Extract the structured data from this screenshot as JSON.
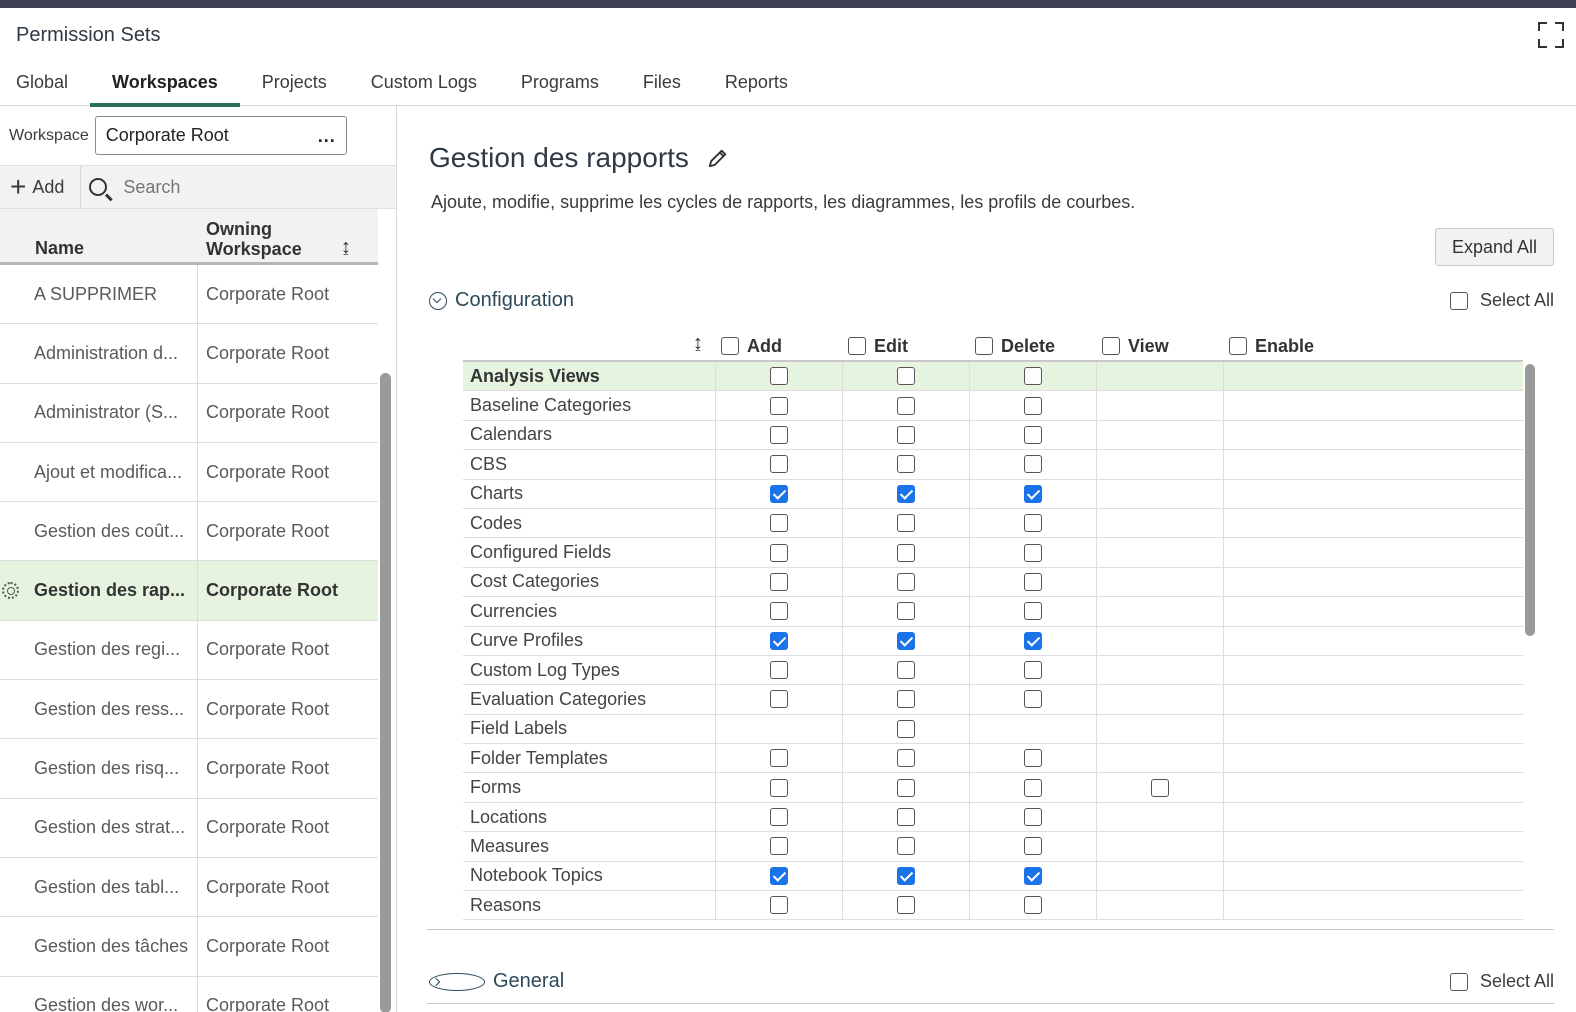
{
  "header": {
    "title": "Permission Sets"
  },
  "tabs": [
    "Global",
    "Workspaces",
    "Projects",
    "Custom Logs",
    "Programs",
    "Files",
    "Reports"
  ],
  "active_tab": "Workspaces",
  "workspace": {
    "label": "Workspace",
    "value": "Corporate Root",
    "more": "..."
  },
  "toolbar": {
    "add_label": "Add",
    "search_placeholder": "Search"
  },
  "grid": {
    "col_name": "Name",
    "col_ws": "Owning Workspace",
    "rows": [
      {
        "name": "A SUPPRIMER",
        "ws": "Corporate Root"
      },
      {
        "name": "Administration d...",
        "ws": "Corporate Root"
      },
      {
        "name": "Administrator (S...",
        "ws": "Corporate Root"
      },
      {
        "name": "Ajout et modifica...",
        "ws": "Corporate Root"
      },
      {
        "name": "Gestion des coût...",
        "ws": "Corporate Root"
      },
      {
        "name": "Gestion des rap...",
        "ws": "Corporate Root"
      },
      {
        "name": "Gestion des regi...",
        "ws": "Corporate Root"
      },
      {
        "name": "Gestion des ress...",
        "ws": "Corporate Root"
      },
      {
        "name": "Gestion des risq...",
        "ws": "Corporate Root"
      },
      {
        "name": "Gestion des strat...",
        "ws": "Corporate Root"
      },
      {
        "name": "Gestion des tabl...",
        "ws": "Corporate Root"
      },
      {
        "name": "Gestion des tâches",
        "ws": "Corporate Root"
      },
      {
        "name": "Gestion des wor...",
        "ws": "Corporate Root"
      }
    ],
    "selected_index": 5
  },
  "detail": {
    "title": "Gestion des rapports",
    "description": "Ajoute, modifie, supprime les cycles de rapports, les diagrammes, les profils de courbes.",
    "expand_all": "Expand All",
    "select_all": "Select All"
  },
  "sections": {
    "configuration": "Configuration",
    "general": "General"
  },
  "perm_columns": [
    "Add",
    "Edit",
    "Delete",
    "View",
    "Enable"
  ],
  "perm_rows": [
    {
      "name": "Analysis Views",
      "add": false,
      "edit": false,
      "delete": false,
      "view": null
    },
    {
      "name": "Baseline Categories",
      "add": false,
      "edit": false,
      "delete": false,
      "view": null
    },
    {
      "name": "Calendars",
      "add": false,
      "edit": false,
      "delete": false,
      "view": null
    },
    {
      "name": "CBS",
      "add": false,
      "edit": false,
      "delete": false,
      "view": null
    },
    {
      "name": "Charts",
      "add": true,
      "edit": true,
      "delete": true,
      "view": null
    },
    {
      "name": "Codes",
      "add": false,
      "edit": false,
      "delete": false,
      "view": null
    },
    {
      "name": "Configured Fields",
      "add": false,
      "edit": false,
      "delete": false,
      "view": null
    },
    {
      "name": "Cost Categories",
      "add": false,
      "edit": false,
      "delete": false,
      "view": null
    },
    {
      "name": "Currencies",
      "add": false,
      "edit": false,
      "delete": false,
      "view": null
    },
    {
      "name": "Curve Profiles",
      "add": true,
      "edit": true,
      "delete": true,
      "view": null
    },
    {
      "name": "Custom Log Types",
      "add": false,
      "edit": false,
      "delete": false,
      "view": null
    },
    {
      "name": "Evaluation Categories",
      "add": false,
      "edit": false,
      "delete": false,
      "view": null
    },
    {
      "name": "Field Labels",
      "add": null,
      "edit": false,
      "delete": null,
      "view": null
    },
    {
      "name": "Folder Templates",
      "add": false,
      "edit": false,
      "delete": false,
      "view": null
    },
    {
      "name": "Forms",
      "add": false,
      "edit": false,
      "delete": false,
      "view": false
    },
    {
      "name": "Locations",
      "add": false,
      "edit": false,
      "delete": false,
      "view": null
    },
    {
      "name": "Measures",
      "add": false,
      "edit": false,
      "delete": false,
      "view": null
    },
    {
      "name": "Notebook Topics",
      "add": true,
      "edit": true,
      "delete": true,
      "view": null
    },
    {
      "name": "Reasons",
      "add": false,
      "edit": false,
      "delete": false,
      "view": null
    }
  ]
}
